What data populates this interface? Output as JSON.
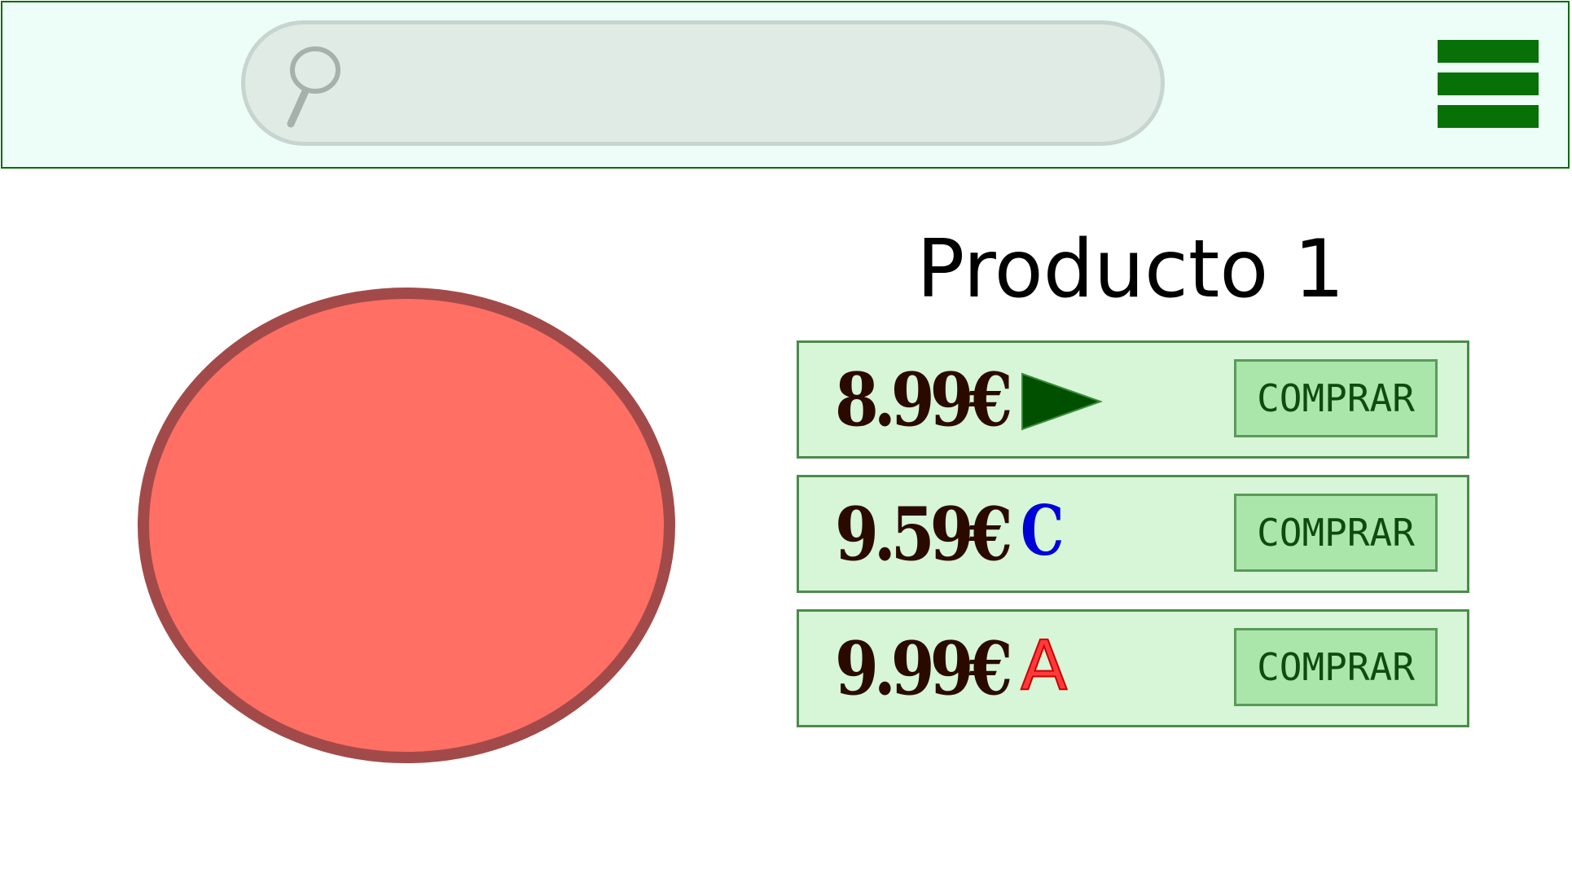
{
  "header": {
    "search": {
      "value": "",
      "placeholder": ""
    },
    "icons": {
      "search": "search-icon",
      "menu": "hamburger-menu-icon"
    }
  },
  "product": {
    "title": "Producto 1",
    "image_icon": "red-circle-shape",
    "offers": [
      {
        "price": "8.99€",
        "badge": "play-icon",
        "badge_color": "#005000",
        "buy_label": "COMPRAR"
      },
      {
        "price": "9.59€",
        "badge": "C",
        "badge_color": "#0000d8",
        "buy_label": "COMPRAR"
      },
      {
        "price": "9.99€",
        "badge": "A",
        "badge_color": "#ff3a3a",
        "buy_label": "COMPRAR"
      }
    ]
  },
  "colors": {
    "header_bg": "#ecfef7",
    "header_border": "#0b6b0b",
    "menu": "#077007",
    "offer_bg": "#d7f5d7",
    "button_bg": "#aae6aa",
    "circle_fill": "#ff6f64",
    "circle_stroke": "#a24a4a",
    "price_text": "#2a0a00"
  }
}
